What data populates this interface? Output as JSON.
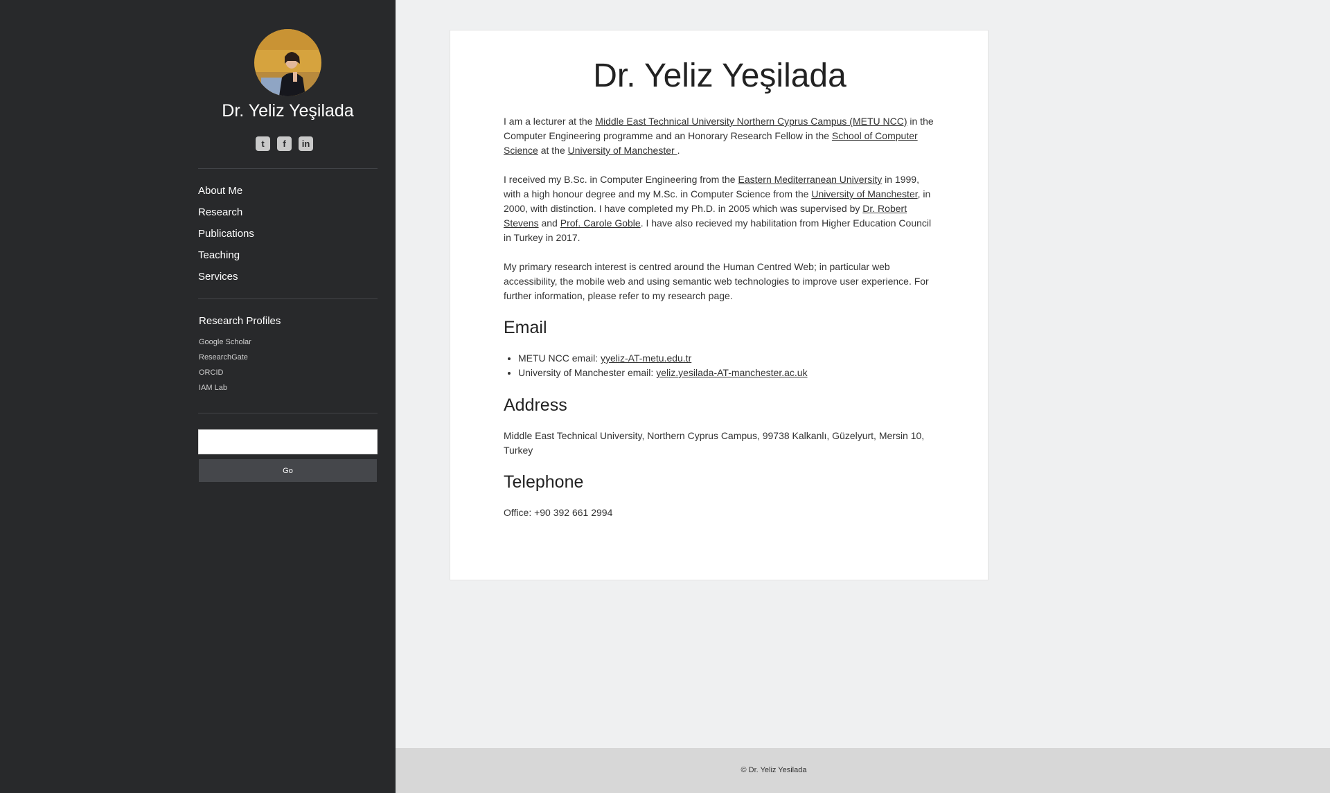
{
  "sidebar": {
    "site_name": "Dr. Yeliz Yeşilada",
    "social": [
      {
        "icon": "twitter-icon",
        "glyph": "t"
      },
      {
        "icon": "facebook-icon",
        "glyph": "f"
      },
      {
        "icon": "linkedin-icon",
        "glyph": "in"
      }
    ],
    "nav": [
      "About Me",
      "Research",
      "Publications",
      "Teaching",
      "Services"
    ],
    "profiles_title": "Research Profiles",
    "profiles": [
      "Google Scholar",
      "ResearchGate",
      "ORCID",
      "IAM Lab"
    ],
    "search_value": "",
    "go_label": "Go"
  },
  "main": {
    "title": "Dr. Yeliz Yeşilada",
    "p1": {
      "t1": "I am a lecturer at the ",
      "link1": "Middle East Technical University Northern Cyprus Campus (METU NCC)",
      "t2": " in the Computer Engineering programme and an Honorary Research Fellow in the ",
      "link2": "School of Computer Science",
      "t3": " at the ",
      "link3": "University of Manchester ",
      "t4": "."
    },
    "p2": {
      "t1": "I received my B.Sc. in Computer Engineering from the ",
      "link1": "Eastern Mediterranean University",
      "t2": " in 1999, with a high honour degree and my M.Sc. in Computer Science from the ",
      "link2": "University of Manchester",
      "t3": ", in 2000, with distinction. I have completed my Ph.D. in 2005 which was supervised by ",
      "link3": "Dr. Robert Stevens",
      "t4": " and ",
      "link4": "Prof. Carole Goble",
      "t5": ". I have also recieved my habilitation from Higher Education Council in Turkey in 2017."
    },
    "p3": "My primary research interest is centred around the Human Centred Web; in particular web accessibility, the mobile web and using semantic web technologies to improve user experience. For further information, please refer to my research page.",
    "email_heading": "Email",
    "email": {
      "metu_label": "METU NCC email: ",
      "metu_value": "yyeliz-AT-metu.edu.tr",
      "man_label": "University of Manchester email: ",
      "man_value": "yeliz.yesilada-AT-manchester.ac.uk"
    },
    "address_heading": "Address",
    "address": "Middle East Technical University, Northern Cyprus Campus, 99738 Kalkanlı, Güzelyurt, Mersin 10, Turkey",
    "telephone_heading": "Telephone",
    "telephone": "Office: +90 392 661 2994"
  },
  "footer": {
    "text": "© Dr. Yeliz Yesilada"
  }
}
